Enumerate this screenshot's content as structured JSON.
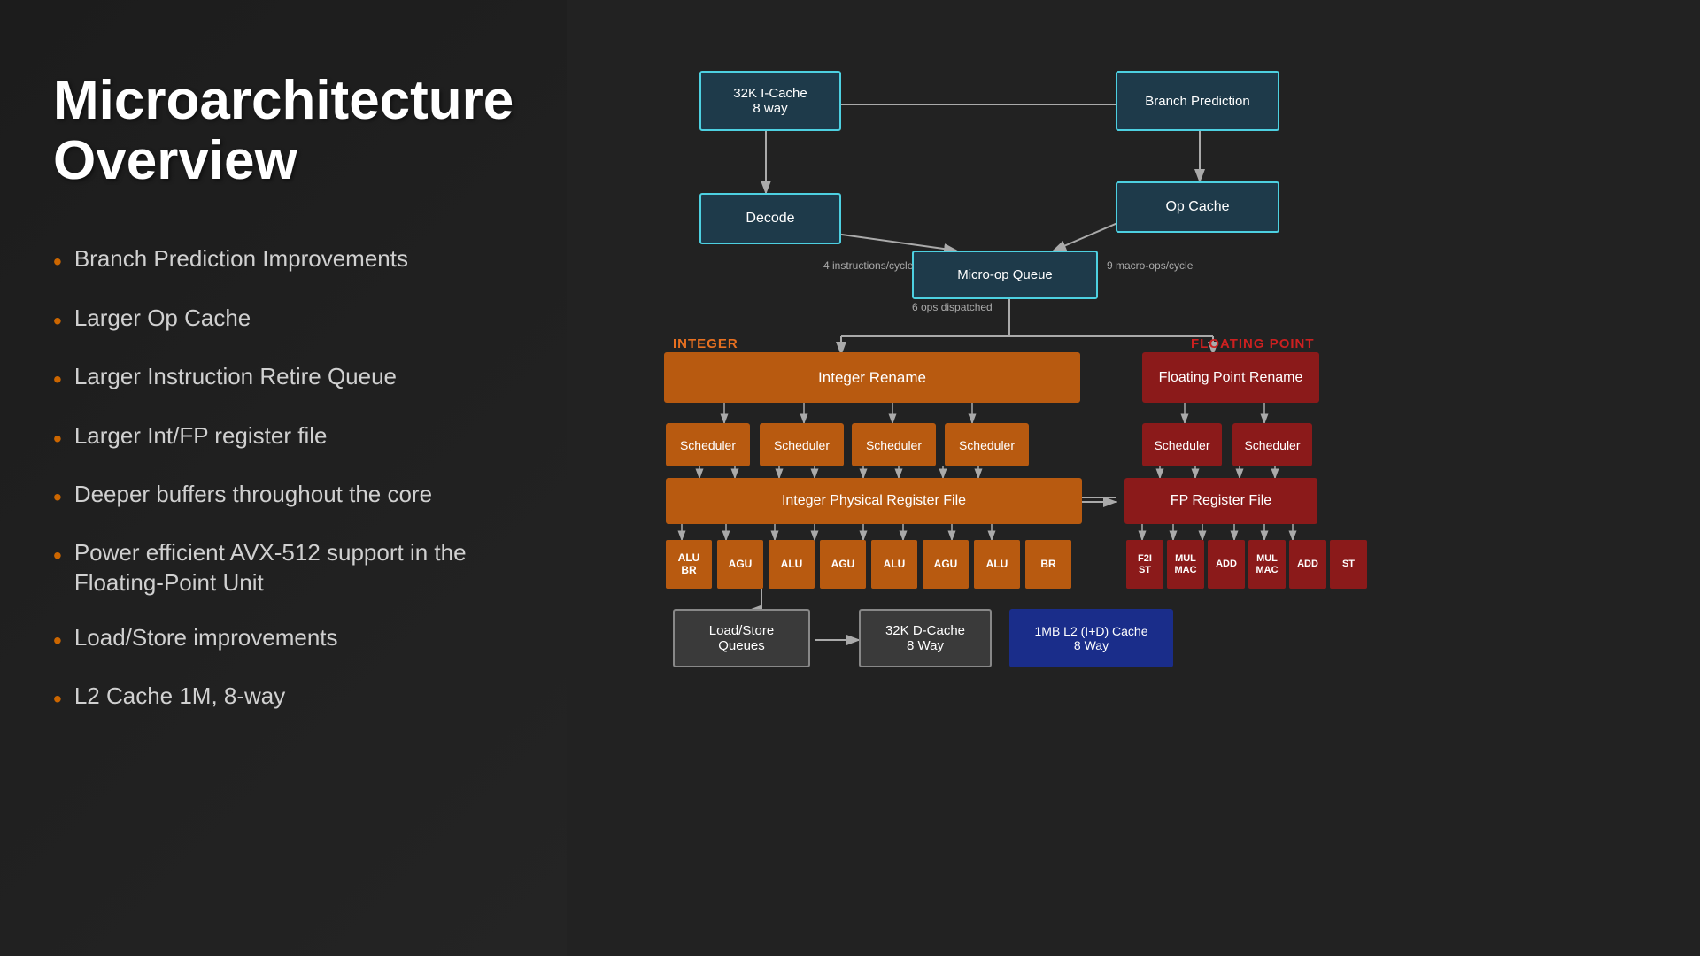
{
  "left": {
    "title": "Microarchitecture Overview",
    "bullets": [
      "Branch Prediction Improvements",
      "Larger Op Cache",
      "Larger Instruction Retire Queue",
      "Larger Int/FP register file",
      "Deeper buffers throughout the core",
      "Power efficient AVX-512 support in the Floating-Point Unit",
      "Load/Store improvements",
      "L2 Cache 1M, 8-way"
    ]
  },
  "diagram": {
    "boxes": {
      "icache": "32K I-Cache\n8 way",
      "branch_pred": "Branch Prediction",
      "decode": "Decode",
      "op_cache": "Op Cache",
      "uop_queue": "Micro-op Queue",
      "int_rename": "Integer Rename",
      "fp_rename": "Floating Point Rename",
      "sched1": "Scheduler",
      "sched2": "Scheduler",
      "sched3": "Scheduler",
      "sched4": "Scheduler",
      "sched5": "Scheduler",
      "sched6": "Scheduler",
      "int_regfile": "Integer Physical Register File",
      "fp_regfile": "FP Register File",
      "loadstore": "Load/Store\nQueues",
      "dcache": "32K D-Cache\n8 Way",
      "l2cache": "1MB L2 (I+D) Cache\n8 Way"
    },
    "exec_units_int": [
      "ALU\nBR",
      "AGU",
      "ALU",
      "AGU",
      "ALU",
      "AGU",
      "ALU",
      "BR"
    ],
    "exec_units_fp": [
      "F2I\nST",
      "MUL\nMAC",
      "ADD",
      "MUL\nMAC",
      "ADD",
      "ST"
    ],
    "labels": {
      "integer": "INTEGER",
      "floating_point": "FLOATING POINT",
      "instructions_cycle": "4 instructions/cycle",
      "ops_dispatched": "6 ops dispatched",
      "macro_ops": "9 macro-ops/cycle"
    }
  }
}
